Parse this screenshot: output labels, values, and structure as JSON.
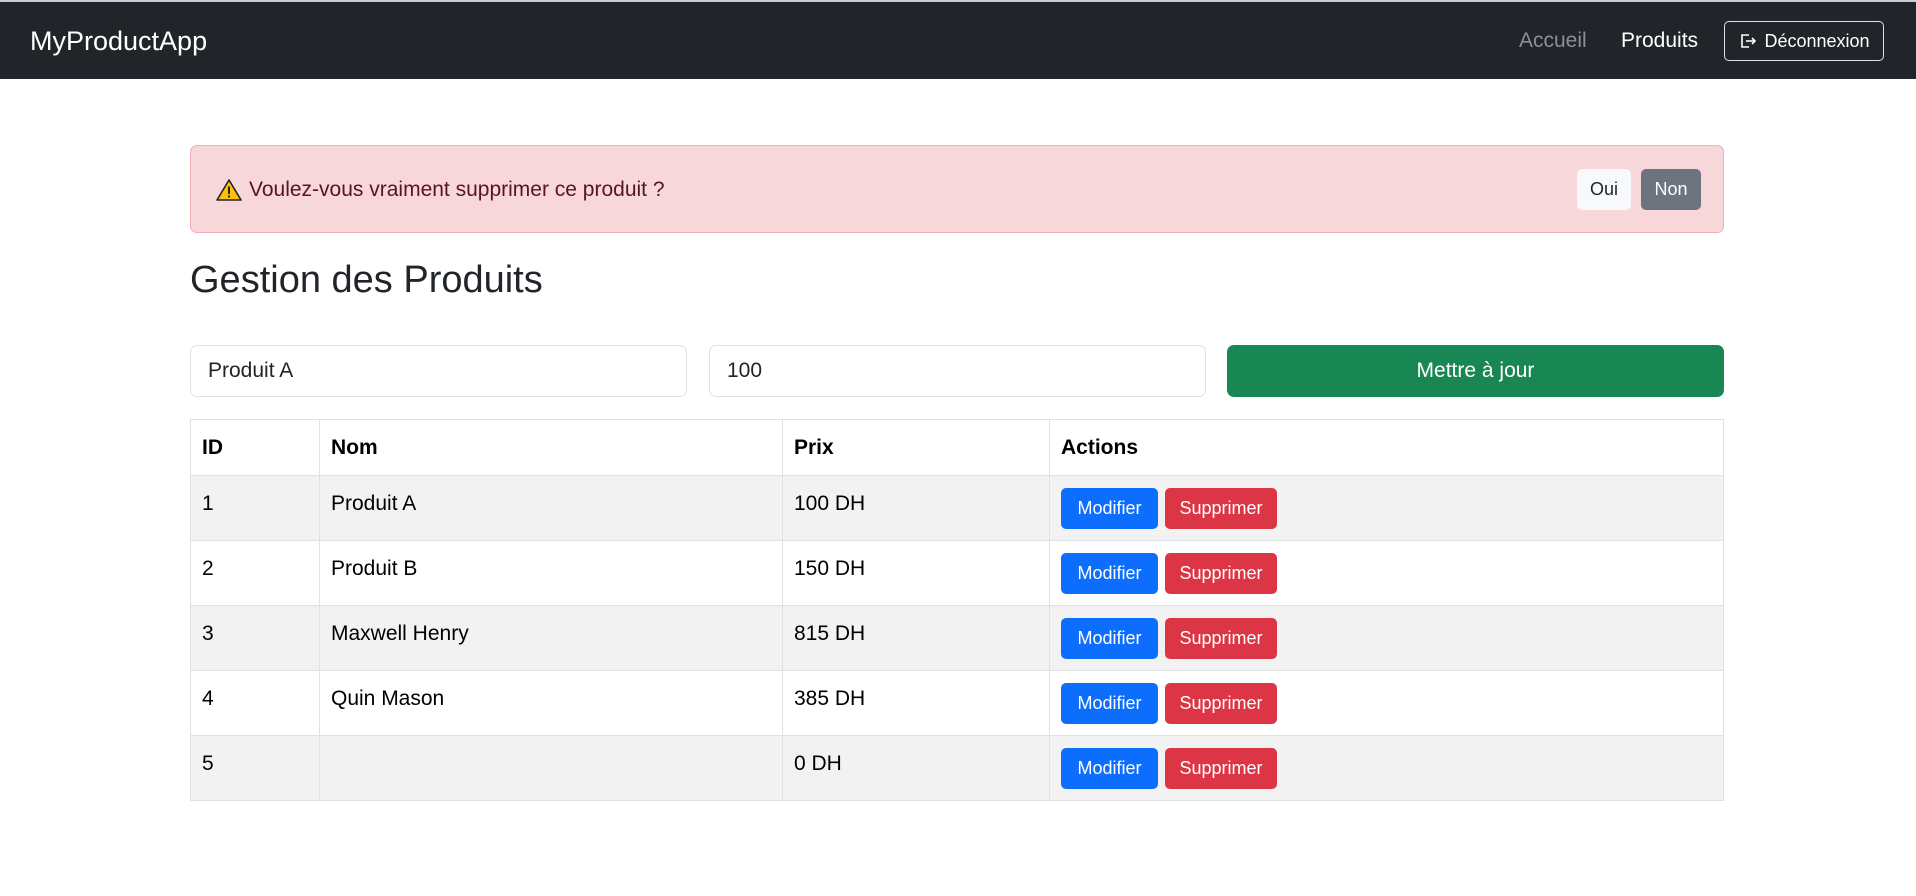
{
  "navbar": {
    "brand": "MyProductApp",
    "links": [
      {
        "label": "Accueil",
        "active": false
      },
      {
        "label": "Produits",
        "active": true
      }
    ],
    "logout_label": "Déconnexion",
    "logout_icon": "logout-icon"
  },
  "alert": {
    "icon": "warning-icon",
    "message": "Voulez-vous vraiment supprimer ce produit ?",
    "yes_label": "Oui",
    "no_label": "Non"
  },
  "page": {
    "title": "Gestion des Produits"
  },
  "form": {
    "name_value": "Produit A",
    "price_value": "100",
    "submit_label": "Mettre à jour"
  },
  "table": {
    "headers": [
      "ID",
      "Nom",
      "Prix",
      "Actions"
    ],
    "rows": [
      {
        "id": "1",
        "nom": "Produit A",
        "prix": "100 DH"
      },
      {
        "id": "2",
        "nom": "Produit B",
        "prix": "150 DH"
      },
      {
        "id": "3",
        "nom": "Maxwell Henry",
        "prix": "815 DH"
      },
      {
        "id": "4",
        "nom": "Quin Mason",
        "prix": "385 DH"
      },
      {
        "id": "5",
        "nom": "",
        "prix": "0 DH"
      }
    ],
    "edit_label": "Modifier",
    "delete_label": "Supprimer"
  },
  "colors": {
    "navbar_bg": "#212529",
    "alert_bg": "#f8d7da",
    "success": "#198754",
    "primary": "#0d6efd",
    "danger": "#dc3545",
    "secondary": "#6c757d"
  }
}
